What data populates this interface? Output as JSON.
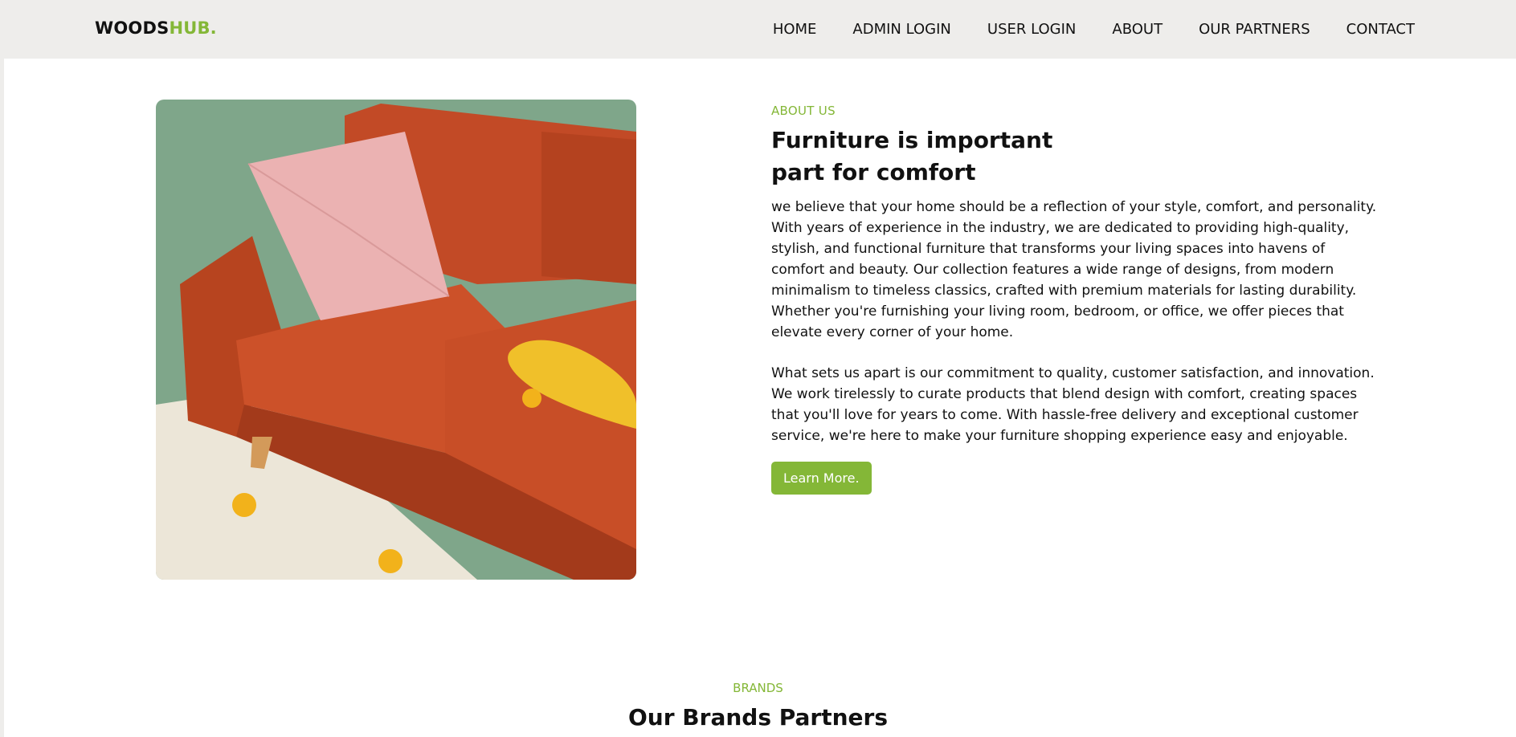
{
  "brand": {
    "name_main": "WOODS",
    "name_accent": "HUB.",
    "accent_color": "#84b737"
  },
  "nav": {
    "items": [
      {
        "label": "HOME"
      },
      {
        "label": "ADMIN LOGIN"
      },
      {
        "label": "USER LOGIN"
      },
      {
        "label": "ABOUT"
      },
      {
        "label": "OUR PARTNERS"
      },
      {
        "label": "CONTACT"
      }
    ]
  },
  "about": {
    "image_icon": "orange-sofa-photo",
    "eyebrow": "ABOUT US",
    "title": "Furniture is important part for comfort",
    "paragraph_1": "we believe that your home should be a reflection of your style, comfort, and personality. With years of experience in the industry, we are dedicated to providing high-quality, stylish, and functional furniture that transforms your living spaces into havens of comfort and beauty. Our collection features a wide range of designs, from modern minimalism to timeless classics, crafted with premium materials for lasting durability. Whether you're furnishing your living room, bedroom, or office, we offer pieces that elevate every corner of your home.",
    "paragraph_2": "What sets us apart is our commitment to quality, customer satisfaction, and innovation. We work tirelessly to curate products that blend design with comfort, creating spaces that you'll love for years to come. With hassle-free delivery and exceptional customer service, we're here to make your furniture shopping experience easy and enjoyable.",
    "button_label": "Learn More."
  },
  "brands": {
    "eyebrow": "BRANDS",
    "title": "Our Brands Partners"
  }
}
